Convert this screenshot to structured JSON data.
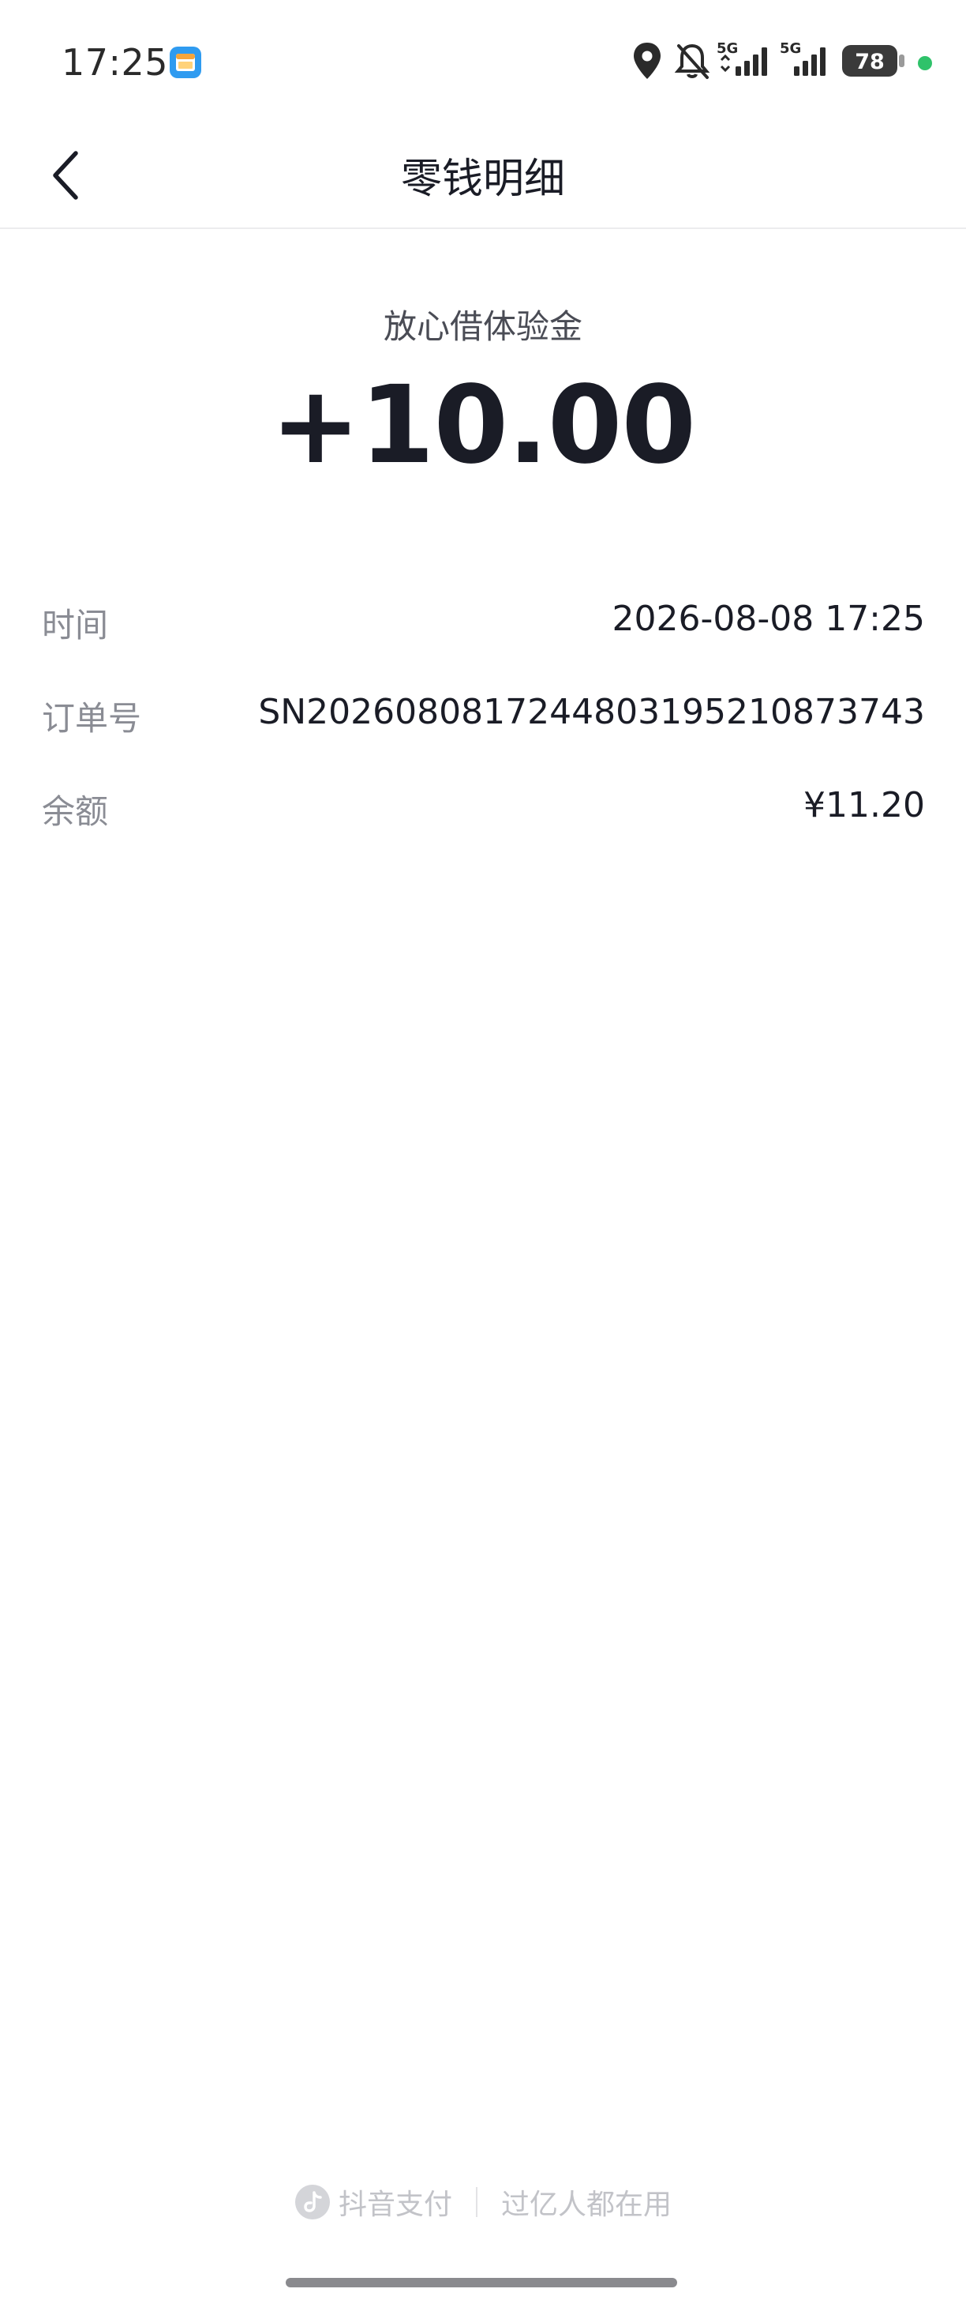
{
  "status_bar": {
    "time": "17:25",
    "network_1": "5G",
    "network_2": "5G",
    "battery": "78",
    "icons": [
      "location-icon",
      "bell-muted-icon",
      "signal-icon",
      "signal-icon",
      "battery-icon"
    ],
    "dot_color": "#2fc26a"
  },
  "nav": {
    "title": "零钱明细",
    "back_icon": "chevron-left-icon"
  },
  "transaction": {
    "label": "放心借体验金",
    "amount": "+10.00"
  },
  "details": [
    {
      "key": "时间",
      "value": "2026-08-08 17:25"
    },
    {
      "key": "订单号",
      "value": "SN20260808172448031952108737​43"
    },
    {
      "key": "余额",
      "value": "¥11.20"
    }
  ],
  "footer": {
    "brand": "抖音支付",
    "slogan": "过亿人都在用"
  }
}
